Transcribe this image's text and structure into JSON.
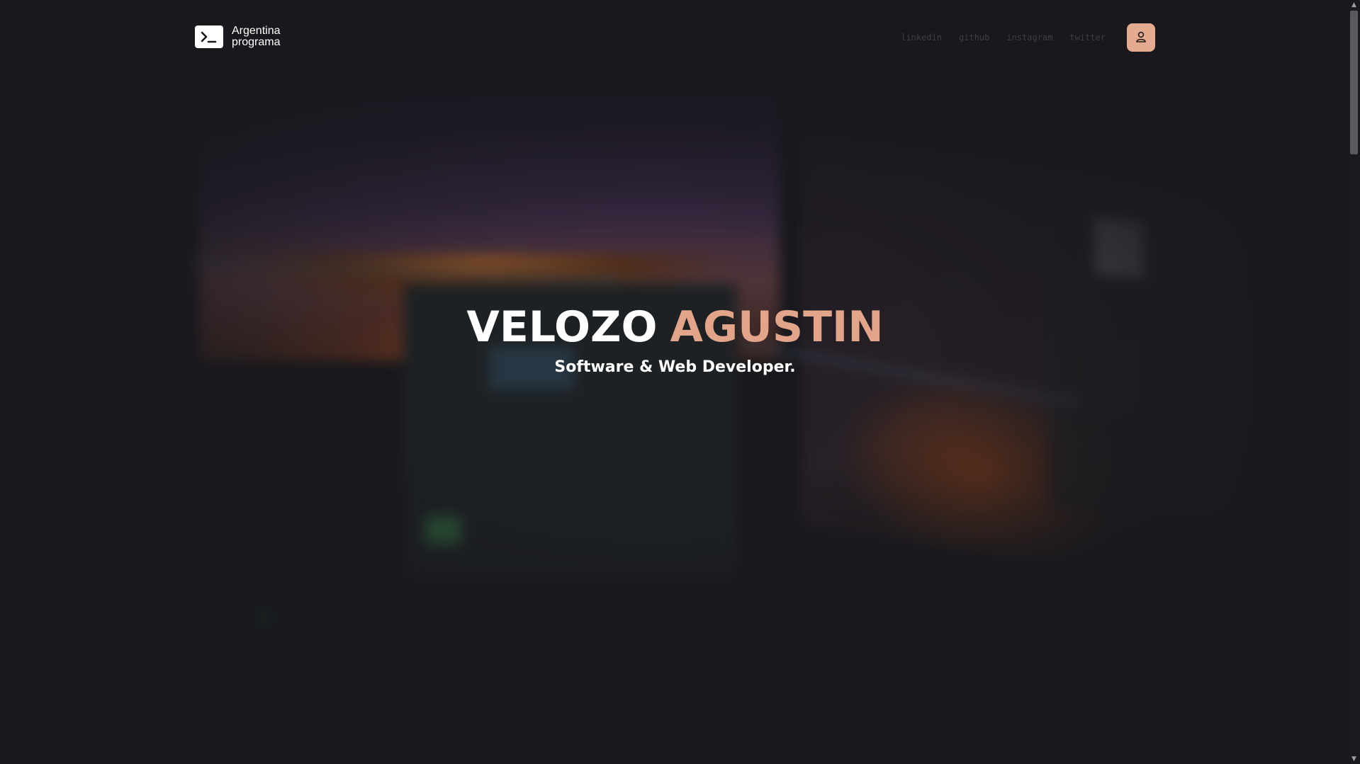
{
  "brand": {
    "line1": "Argentina",
    "line2": "programa",
    "icon": "terminal-prompt-icon"
  },
  "nav": {
    "links": [
      "linkedin",
      "github",
      "instagram",
      "twitter"
    ],
    "user_icon": "user-icon"
  },
  "hero": {
    "first_name": "VELOZO",
    "last_name": "AGUSTIN",
    "subtitle": "Software & Web Developer."
  },
  "colors": {
    "background": "#18181d",
    "accent": "#e3a58a",
    "user_button": "#e4ab91",
    "nav_text": "#3d3d44"
  }
}
